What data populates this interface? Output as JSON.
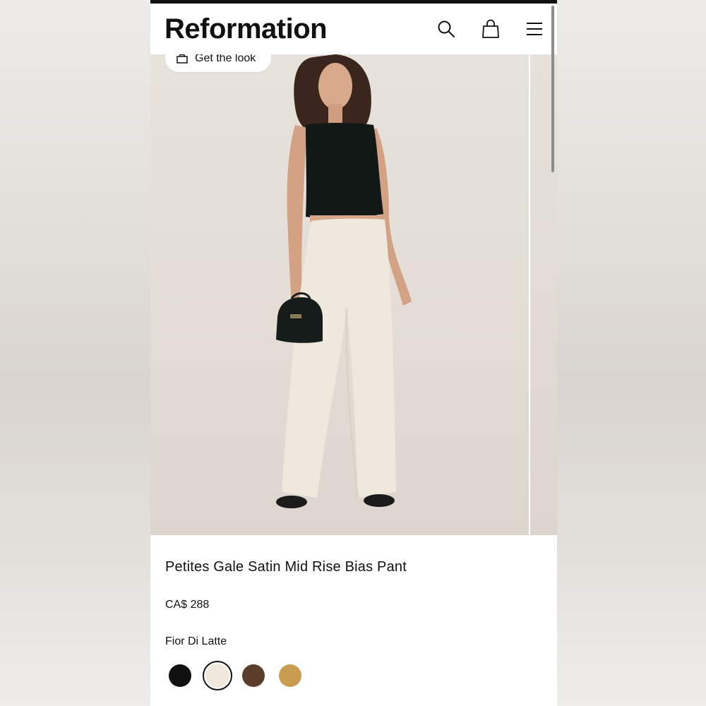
{
  "brand": {
    "logo_text": "Reformation"
  },
  "header": {
    "icons": [
      "search-icon",
      "bag-icon",
      "menu-icon"
    ]
  },
  "hero": {
    "get_the_look_label": "Get the look",
    "image_description_icon": "product-photo"
  },
  "product": {
    "title": "Petites Gale Satin Mid Rise Bias Pant",
    "price": "CA$ 288",
    "selected_color": "Fior Di Latte",
    "swatches": [
      {
        "name": "black",
        "hex": "#111111",
        "selected": false
      },
      {
        "name": "fior-di-latte",
        "hex": "#efe8dc",
        "selected": true
      },
      {
        "name": "brown",
        "hex": "#5a3e29",
        "selected": false
      },
      {
        "name": "tan",
        "hex": "#c89d52",
        "selected": false
      }
    ]
  }
}
